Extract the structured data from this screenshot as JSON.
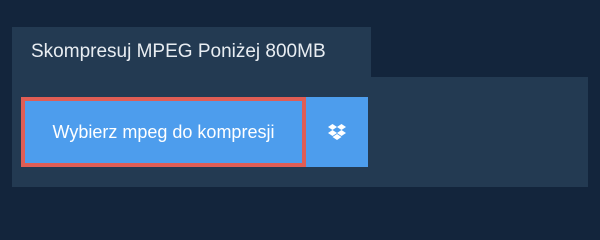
{
  "tab": {
    "title": "Skompresuj MPEG Poniżej 800MB"
  },
  "upload": {
    "choose_label": "Wybierz mpeg do kompresji",
    "dropbox_icon": "dropbox-icon"
  },
  "colors": {
    "background": "#13253c",
    "panel": "#233a52",
    "button": "#4d9ded",
    "highlight_border": "#e05d54"
  }
}
